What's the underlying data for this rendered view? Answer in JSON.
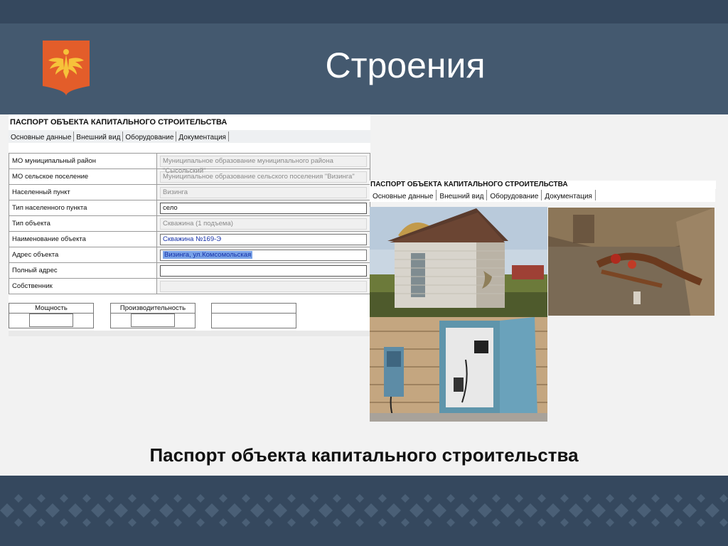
{
  "slide": {
    "title": "Строения",
    "caption": "Паспорт объекта капитального строительства"
  },
  "colors": {
    "header_bg": "#44596f",
    "top_strip": "#35485e",
    "emblem_bg": "#e35d2a",
    "emblem_bird": "#f6c23a"
  },
  "form": {
    "title": "ПАСПОРТ ОБЪЕКТА КАПИТАЛЬНОГО СТРОИТЕЛЬСТВА",
    "tabs": [
      "Основные данные",
      "Внешний вид",
      "Оборудование",
      "Документация"
    ],
    "rows": [
      {
        "label": "МО муниципальный район",
        "value": "Муниципальное образование муниципального района \"Сысольский\""
      },
      {
        "label": "МО сельское поселение",
        "value": "Муниципальное образование сельского поселения \"Визинга\""
      },
      {
        "label": "Населенный пункт",
        "value": "Визинга"
      },
      {
        "label": "Тип населенного пункта",
        "value": "село"
      },
      {
        "label": "Тип объекта",
        "value": "Скважина (1 подъема)"
      },
      {
        "label": "Наименование объекта",
        "value": "Скважина №169-Э"
      },
      {
        "label": "Адрес объекта",
        "value": "Визинга, ул.Комсомольская"
      },
      {
        "label": "Полный адрес",
        "value": ""
      },
      {
        "label": "Собственник",
        "value": ""
      }
    ],
    "mini_boxes": [
      "Мощность",
      "Производительность",
      ""
    ]
  },
  "photo_panel": {
    "title": "ПАСПОРТ ОБЪЕКТА КАПИТАЛЬНОГО СТРОИТЕЛЬСТВА",
    "tabs": [
      "Основные данные",
      "Внешний вид",
      "Оборудование",
      "Документация"
    ]
  }
}
